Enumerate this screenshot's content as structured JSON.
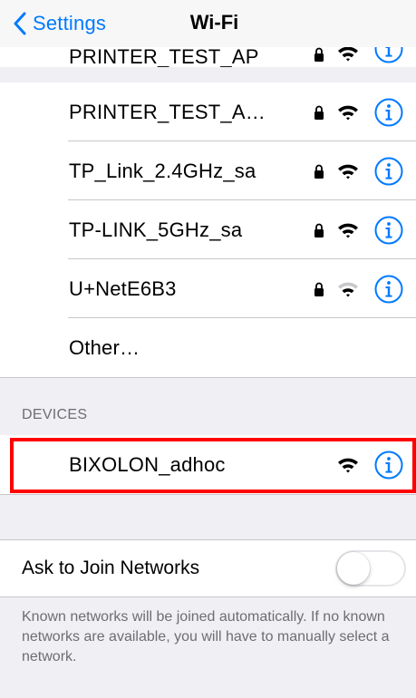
{
  "navbar": {
    "back_label": "Settings",
    "title": "Wi-Fi"
  },
  "networks": {
    "clipped": {
      "label": "PRINTER_TEST_AP",
      "locked": true
    },
    "items": [
      {
        "label": "PRINTER_TEST_A…",
        "locked": true,
        "signal": "full"
      },
      {
        "label": "TP_Link_2.4GHz_sa",
        "locked": true,
        "signal": "full"
      },
      {
        "label": "TP-LINK_5GHz_sa",
        "locked": true,
        "signal": "full"
      },
      {
        "label": "U+NetE6B3",
        "locked": true,
        "signal": "medium"
      },
      {
        "label": "Other…",
        "locked": false
      }
    ]
  },
  "devices": {
    "header": "DEVICES",
    "items": [
      {
        "label": "BIXOLON_adhoc",
        "locked": false,
        "signal": "full",
        "highlighted": true
      }
    ]
  },
  "ask_to_join": {
    "label": "Ask to Join Networks",
    "enabled": false,
    "note": "Known networks will be joined automatically. If no known networks are available, you will have to manually select a network."
  },
  "colors": {
    "accent": "#007aff",
    "highlight": "#ff0000",
    "group_background": "#efeff4",
    "secondary_text": "#6d6d72"
  },
  "icons": [
    "chevron-left-icon",
    "lock-icon",
    "wifi-icon",
    "info-icon"
  ]
}
